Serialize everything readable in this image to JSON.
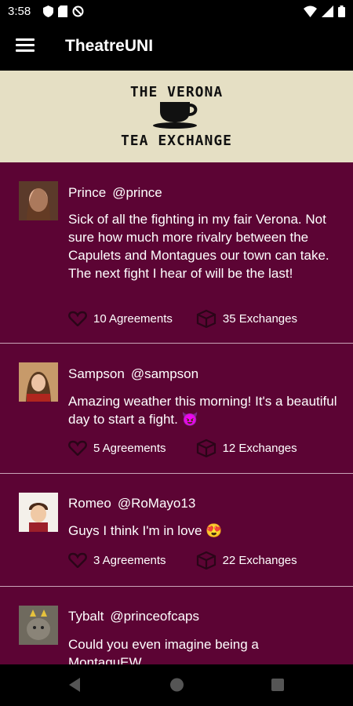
{
  "status": {
    "time": "3:58"
  },
  "appbar": {
    "title": "TheatreUNI",
    "menu_icon": "hamburger-menu-icon"
  },
  "banner": {
    "line1": "THE VERONA",
    "line2": "TEA EXCHANGE",
    "icon": "teacup-icon"
  },
  "posts": [
    {
      "name": "Prince",
      "handle": "@prince",
      "text": "Sick of all the fighting in my fair Verona. Not sure how much more rivalry between the Capulets and Montagues our town can take. The next fight I hear of will be the last!",
      "agreements": "10 Agreements",
      "exchanges": "35 Exchanges"
    },
    {
      "name": "Sampson",
      "handle": "@sampson",
      "text": "Amazing weather this morning! It's a beautiful day to start a fight. 😈",
      "agreements": "5 Agreements",
      "exchanges": "12 Exchanges"
    },
    {
      "name": "Romeo",
      "handle": "@RoMayo13",
      "text": "Guys I think I'm in love 😍",
      "agreements": "3 Agreements",
      "exchanges": "22 Exchanges"
    },
    {
      "name": "Tybalt",
      "handle": "@princeofcaps",
      "text": "Could you even imagine being a MontaguEW",
      "agreements": "",
      "exchanges": ""
    }
  ],
  "colors": {
    "feed_bg": "#5c0434",
    "banner_bg": "#e5dfc4",
    "appbar_bg": "#000000"
  }
}
